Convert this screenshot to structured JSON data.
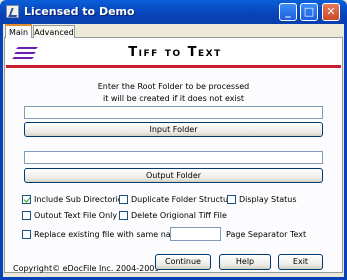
{
  "window": {
    "title": "Licensed to Demo",
    "min": "_",
    "max": "□",
    "close": "✕"
  },
  "tabs": [
    {
      "label": "Main"
    },
    {
      "label": "Advanced"
    }
  ],
  "banner": {
    "title": "Tiff to Text"
  },
  "instructions": {
    "line1": "Enter the Root Folder to be processed",
    "line2": "it will be created if it does not exist"
  },
  "input_folder": {
    "value": "",
    "button_label": "Input Folder"
  },
  "output_folder": {
    "value": "",
    "button_label": "Output Folder"
  },
  "options": {
    "include_sub": {
      "label": "Include Sub Directories",
      "checked": true
    },
    "duplicate_structure": {
      "label": "Duplicate Folder Structure",
      "checked": false
    },
    "display_status": {
      "label": "Display Status",
      "checked": false
    },
    "output_text_only": {
      "label": "Outout Text File Only",
      "checked": false
    },
    "delete_original": {
      "label": "Delete Origional Tiff File",
      "checked": false
    },
    "replace_existing": {
      "label": "Replace existing file with same name",
      "checked": false
    }
  },
  "page_separator": {
    "value": "",
    "label": "Page Separator Text"
  },
  "footer": {
    "copyright": "Copyright© eDocFile Inc. 2004-2009",
    "continue": "Continue",
    "help": "Help",
    "exit": "Exit"
  },
  "colors": {
    "titlebar": "#0842b8",
    "banner_rule": "#c91f2b",
    "logo": "#6b1fb0"
  }
}
